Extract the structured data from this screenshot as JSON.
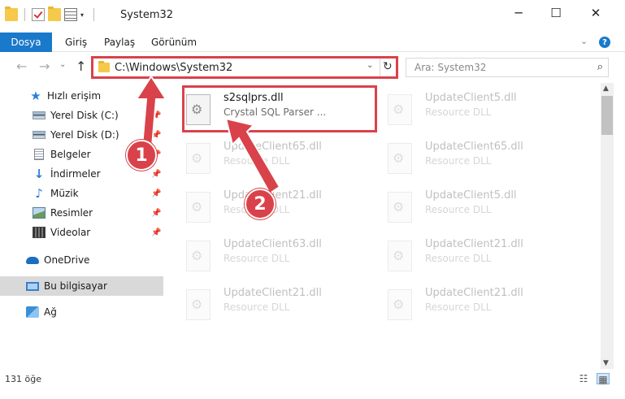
{
  "window": {
    "title": "System32",
    "minimize": "─",
    "maximize": "☐",
    "close": "✕"
  },
  "ribbon": {
    "tabs": [
      "Dosya",
      "Giriş",
      "Paylaş",
      "Görünüm"
    ],
    "collapse_glyph": "⌄",
    "help_glyph": "?"
  },
  "nav": {
    "back": "←",
    "forward": "→",
    "recent": "⌄",
    "up": "↑",
    "address": "C:\\Windows\\System32",
    "address_dropdown": "⌄",
    "refresh": "↻",
    "search_placeholder": "Ara: System32",
    "search_glyph": "⌕"
  },
  "sidebar": {
    "items": [
      {
        "label": "Hızlı erişim",
        "icon": "star-icon"
      },
      {
        "label": "Yerel Disk (C:)",
        "icon": "disk-icon",
        "pinned": true
      },
      {
        "label": "Yerel Disk (D:)",
        "icon": "disk-icon",
        "pinned": true
      },
      {
        "label": "Belgeler",
        "icon": "document-icon",
        "pinned": true
      },
      {
        "label": "İndirmeler",
        "icon": "download-icon",
        "pinned": true
      },
      {
        "label": "Müzik",
        "icon": "music-icon",
        "pinned": true
      },
      {
        "label": "Resimler",
        "icon": "pictures-icon",
        "pinned": true
      },
      {
        "label": "Videolar",
        "icon": "videos-icon",
        "pinned": true
      },
      {
        "label": "OneDrive",
        "icon": "cloud-icon"
      },
      {
        "label": "Bu bilgisayar",
        "icon": "computer-icon",
        "selected": true
      },
      {
        "label": "Ağ",
        "icon": "network-icon"
      }
    ],
    "pin_glyph": "📌"
  },
  "files": [
    {
      "name": "s2sqlprs.dll",
      "desc": "Crystal SQL Parser ..."
    },
    {
      "name": "UpdateClient5.dll",
      "desc": "Resource DLL"
    },
    {
      "name": "UpdateClient65.dll",
      "desc": "Resource DLL"
    },
    {
      "name": "UpdateClient65.dll",
      "desc": "Resource DLL"
    },
    {
      "name": "UpdateClient21.dll",
      "desc": "Resource DLL"
    },
    {
      "name": "UpdateClient5.dll",
      "desc": "Resource DLL"
    },
    {
      "name": "UpdateClient63.dll",
      "desc": "Resource DLL"
    },
    {
      "name": "UpdateClient21.dll",
      "desc": "Resource DLL"
    },
    {
      "name": "UpdateClient21.dll",
      "desc": "Resource DLL"
    },
    {
      "name": "UpdateClient21.dll",
      "desc": "Resource DLL"
    }
  ],
  "status": {
    "count": "131 öğe",
    "details_glyph": "☷",
    "tiles_glyph": "▦"
  },
  "annotations": {
    "step1": "1",
    "step2": "2",
    "color": "#d9424a"
  },
  "scroll": {
    "up": "▲",
    "down": "▼"
  }
}
